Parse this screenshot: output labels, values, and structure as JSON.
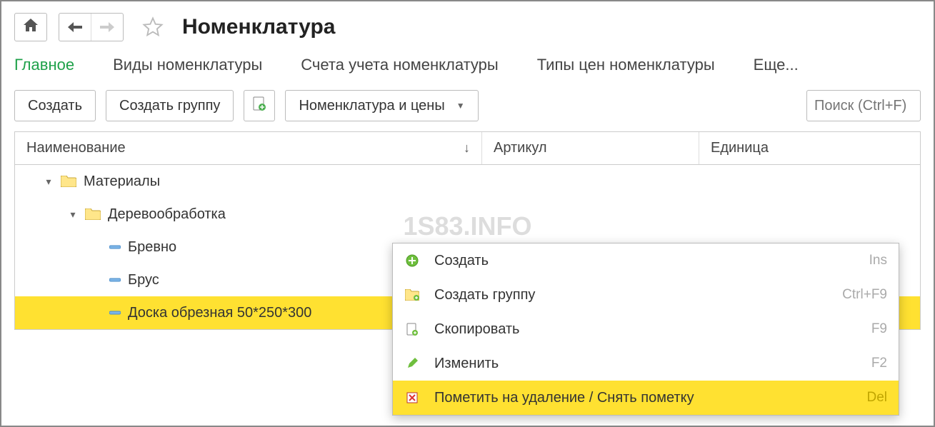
{
  "header": {
    "title": "Номенклатура"
  },
  "tabs": {
    "main": "Главное",
    "types": "Виды номенклатуры",
    "accounts": "Счета учета номенклатуры",
    "price_types": "Типы цен номенклатуры",
    "more": "Еще..."
  },
  "toolbar": {
    "create": "Создать",
    "create_group": "Создать группу",
    "nomenclature_prices": "Номенклатура и цены",
    "search_placeholder": "Поиск (Ctrl+F)"
  },
  "columns": {
    "name": "Наименование",
    "article": "Артикул",
    "unit": "Единица"
  },
  "tree": {
    "materials": "Материалы",
    "woodworking": "Деревообработка",
    "log": "Бревно",
    "beam": "Брус",
    "board": "Доска обрезная 50*250*300"
  },
  "context_menu": {
    "create": {
      "label": "Создать",
      "shortcut": "Ins"
    },
    "create_group": {
      "label": "Создать группу",
      "shortcut": "Ctrl+F9"
    },
    "copy": {
      "label": "Скопировать",
      "shortcut": "F9"
    },
    "edit": {
      "label": "Изменить",
      "shortcut": "F2"
    },
    "mark_delete": {
      "label": "Пометить на удаление / Снять пометку",
      "shortcut": "Del"
    }
  },
  "watermark": "1S83.INFO"
}
